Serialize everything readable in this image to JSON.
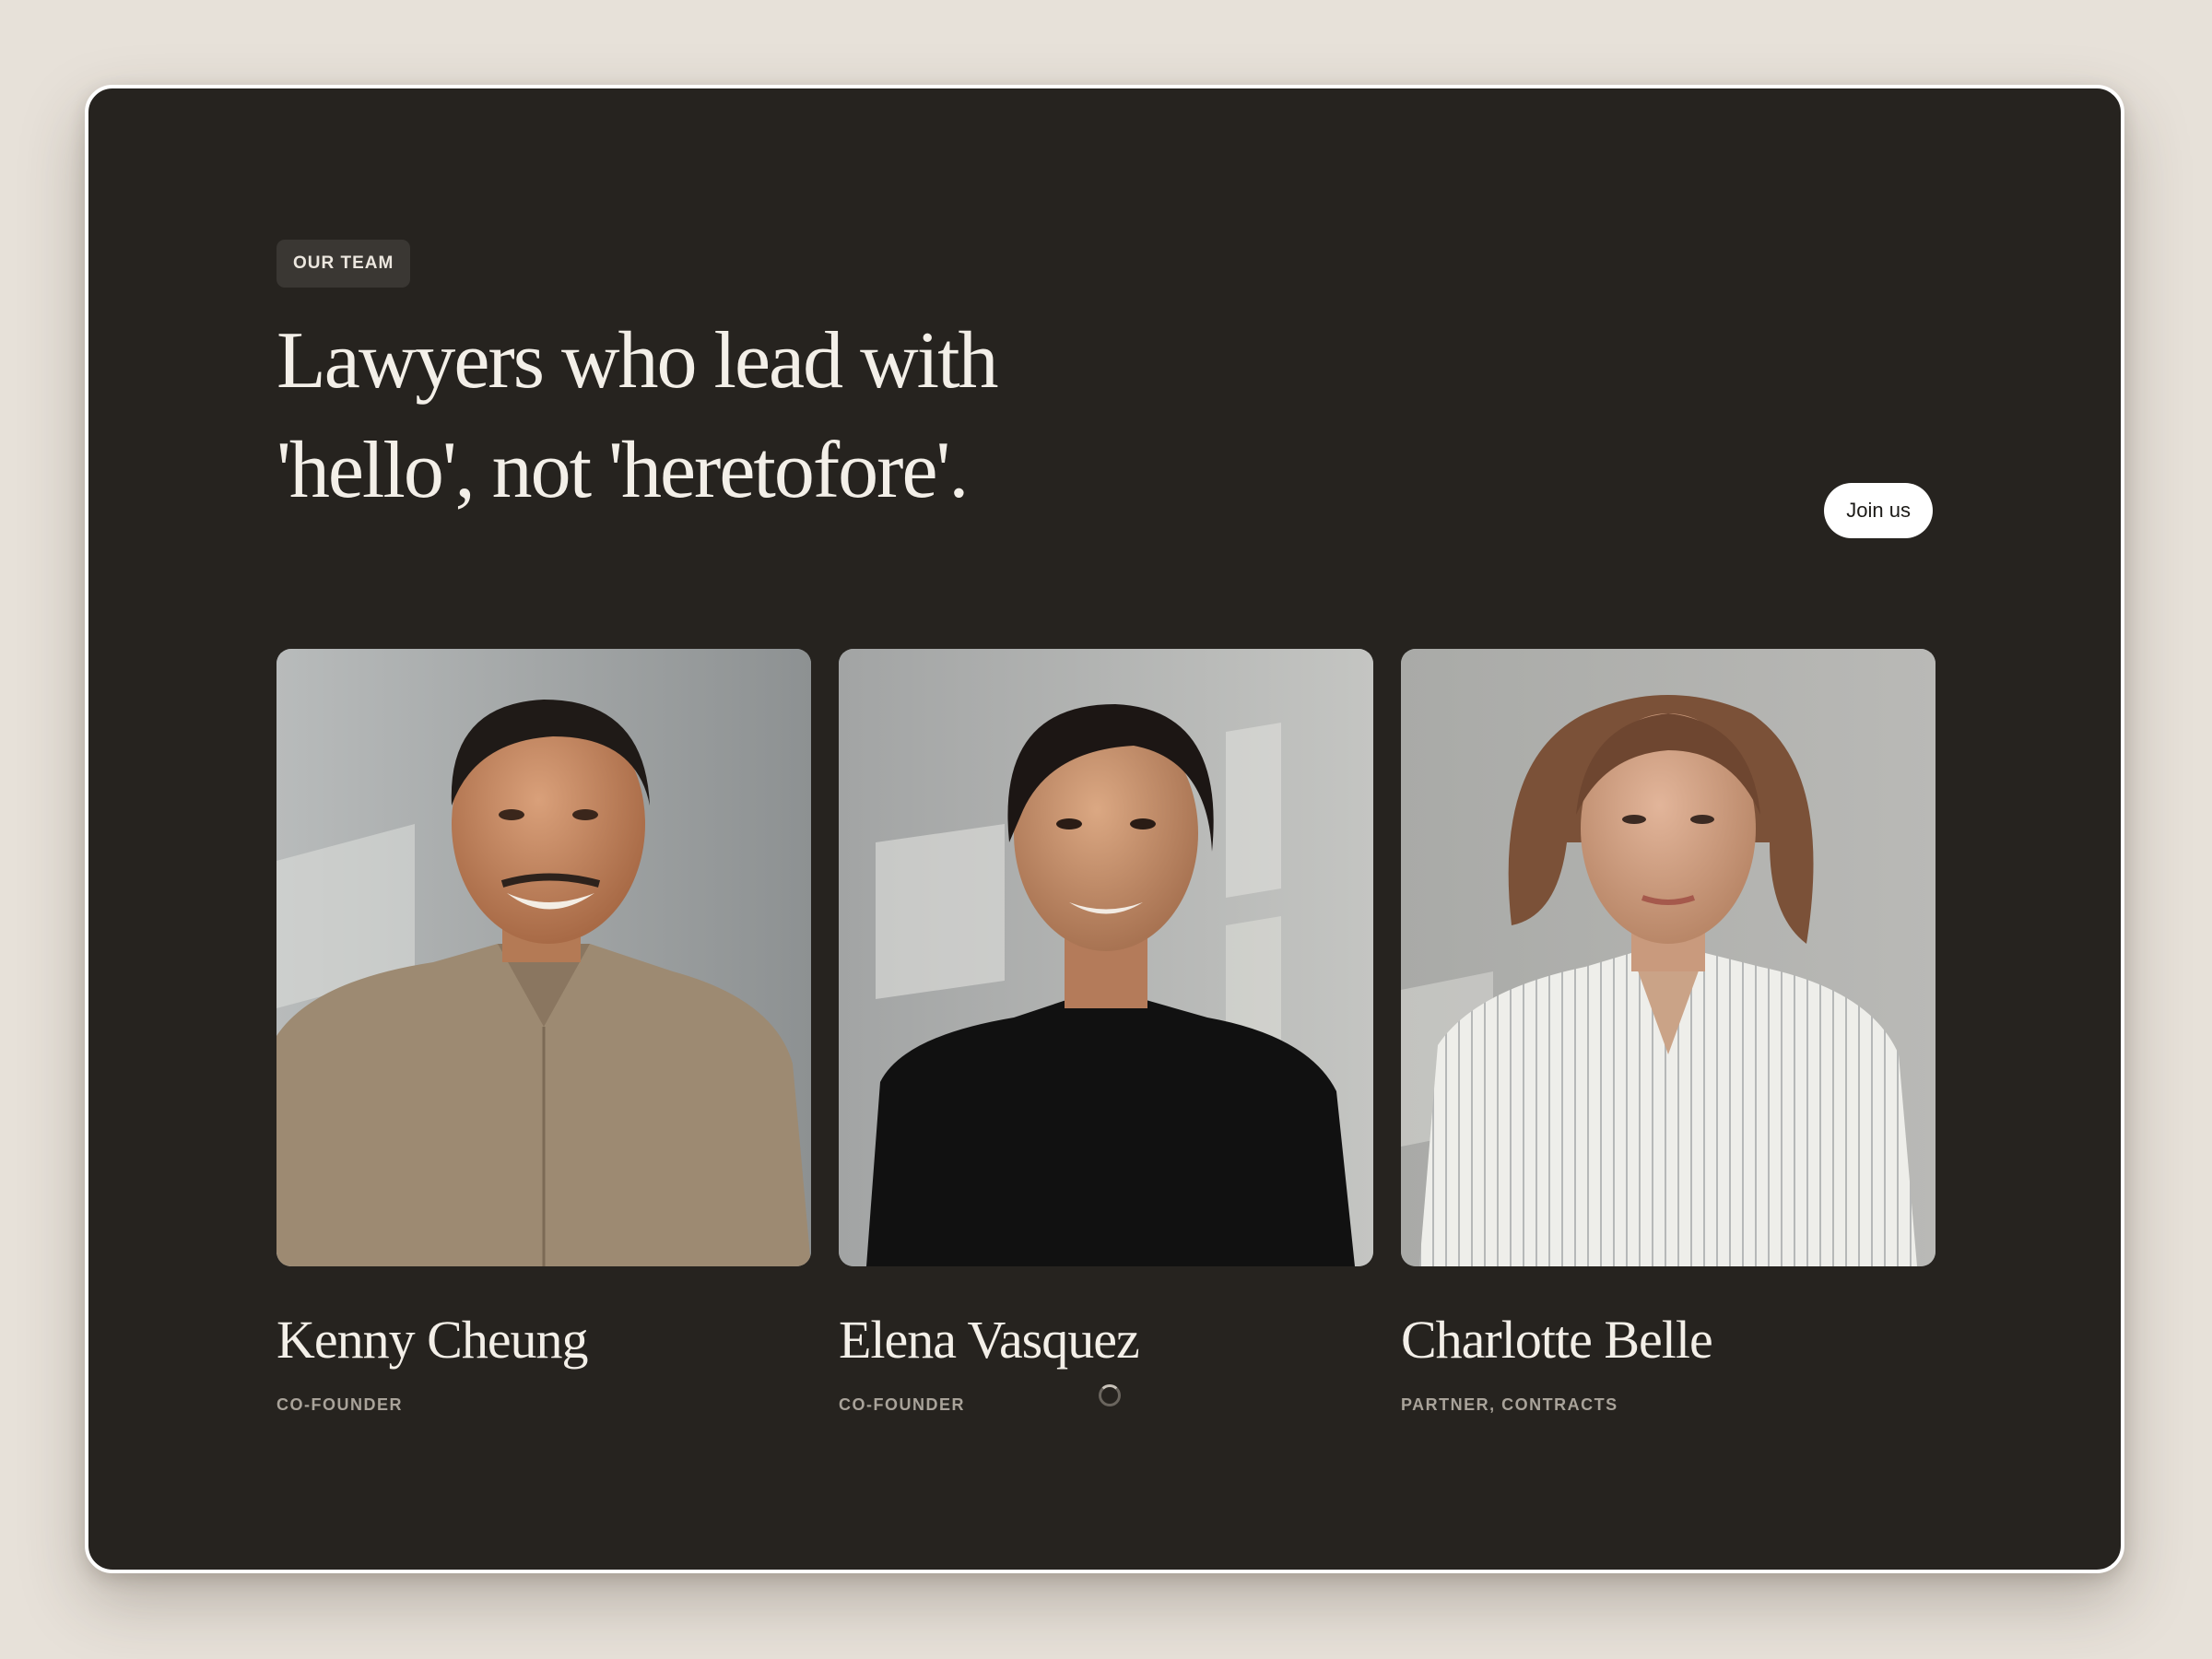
{
  "section": {
    "badge": "OUR TEAM",
    "headline_line1": "Lawyers who lead with",
    "headline_line2": "'hello', not 'heretofore'.",
    "join_button": "Join us"
  },
  "team": [
    {
      "name": "Kenny Cheung",
      "role": "CO-FOUNDER",
      "photo": "portrait-man-beige-shirt"
    },
    {
      "name": "Elena Vasquez",
      "role": "CO-FOUNDER",
      "photo": "portrait-woman-black-top"
    },
    {
      "name": "Charlotte Belle",
      "role": "PARTNER, CONTRACTS",
      "photo": "portrait-woman-striped-shirt"
    }
  ],
  "colors": {
    "page_bg": "#e7e1d9",
    "panel_bg": "#26231f",
    "text_primary": "#f3efe8",
    "text_muted": "#a9a39a",
    "button_bg": "#ffffff"
  },
  "icons": {
    "loading": "loading-spinner-icon"
  }
}
